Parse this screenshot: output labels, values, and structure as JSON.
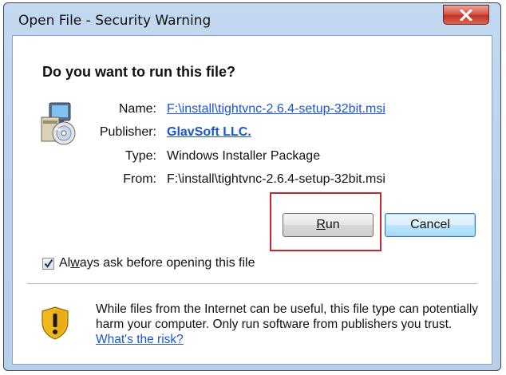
{
  "window": {
    "title": "Open File - Security Warning",
    "close_label": "X"
  },
  "dialog": {
    "question": "Do you want to run this file?",
    "fields": {
      "name_label": "Name:",
      "name_value": "F:\\install\\tightvnc-2.6.4-setup-32bit.msi",
      "publisher_label": "Publisher:",
      "publisher_value": "GlavSoft LLC.",
      "type_label": "Type:",
      "type_value": "Windows Installer Package",
      "from_label": "From:",
      "from_value": "F:\\install\\tightvnc-2.6.4-setup-32bit.msi"
    },
    "buttons": {
      "run_mnemonic": "R",
      "run_rest": "un",
      "cancel": "Cancel"
    },
    "checkbox": {
      "checked": true,
      "label_pre": "Al",
      "label_mnemonic": "w",
      "label_post": "ays ask before opening this file"
    },
    "warning": {
      "text": "While files from the Internet can be useful, this file type can potentially harm your computer. Only run software from publishers you trust.",
      "link": "What's the risk?"
    }
  },
  "icons": {
    "close": "close-icon",
    "installer": "installer-package-icon",
    "shield": "warning-shield-icon",
    "check": "checkmark-icon"
  },
  "colors": {
    "link": "#1a55d3",
    "highlight_box": "#c1272d",
    "titlebar": "#bcd3ee"
  }
}
